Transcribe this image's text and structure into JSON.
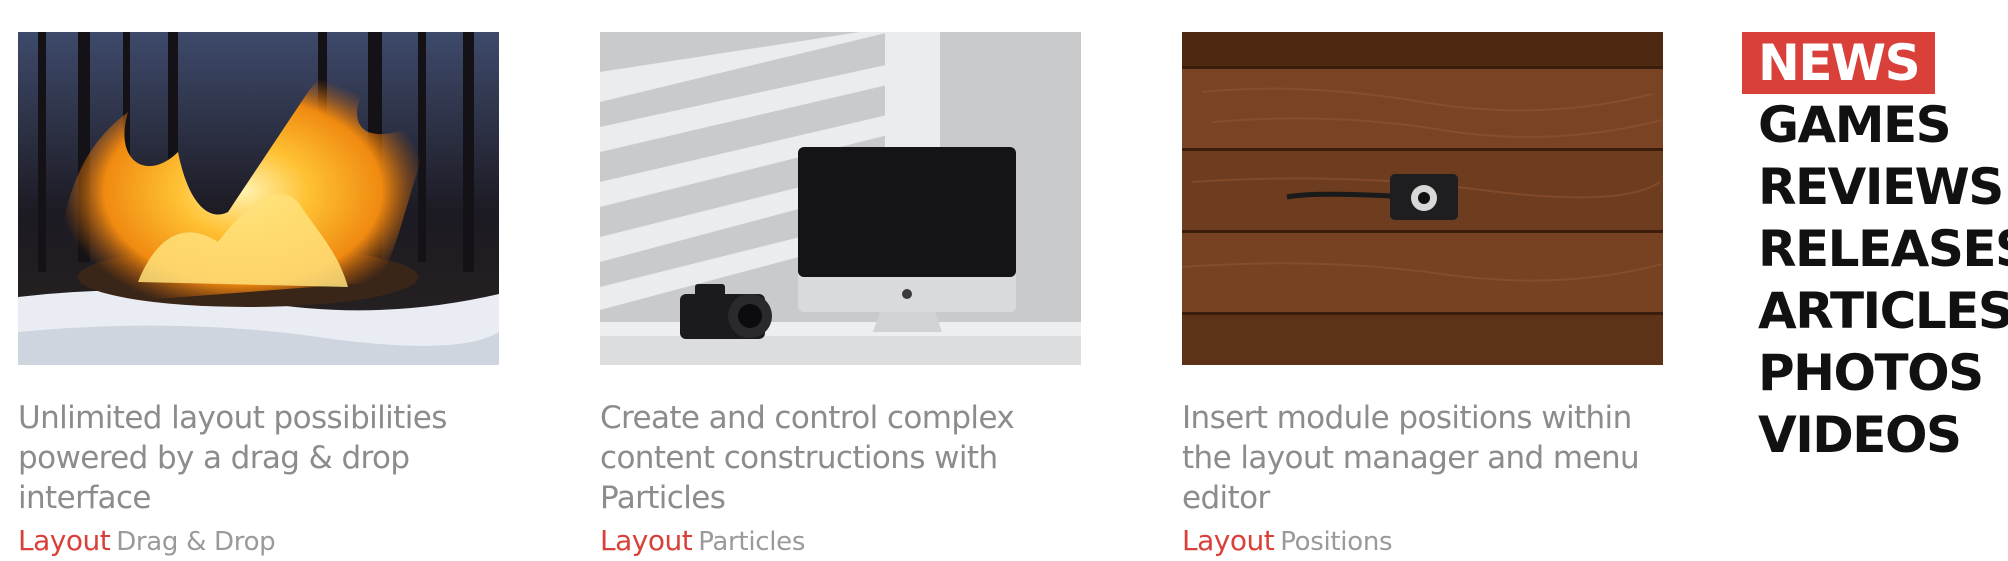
{
  "cards": [
    {
      "image": "burning-log-in-snowy-forest",
      "title": "Unlimited layout possibilities powered by a drag & drop interface",
      "category": "Layout",
      "tag": "Drag & Drop"
    },
    {
      "image": "imac-and-camera-on-desk",
      "title": "Create and control complex content constructions with Particles",
      "category": "Layout",
      "tag": "Particles"
    },
    {
      "image": "camera-on-wooden-boards",
      "title": "Insert module positions within the layout manager and menu editor",
      "category": "Layout",
      "tag": "Positions"
    }
  ],
  "menu": {
    "items": [
      "NEWS",
      "GAMES",
      "REVIEWS",
      "RELEASES",
      "ARTICLES",
      "PHOTOS",
      "VIDEOS"
    ],
    "active": "NEWS"
  },
  "colors": {
    "accent": "#d9403a",
    "title_text": "#8c8c8c",
    "tag_text": "#9a9a9a",
    "menu_text": "#111111"
  }
}
